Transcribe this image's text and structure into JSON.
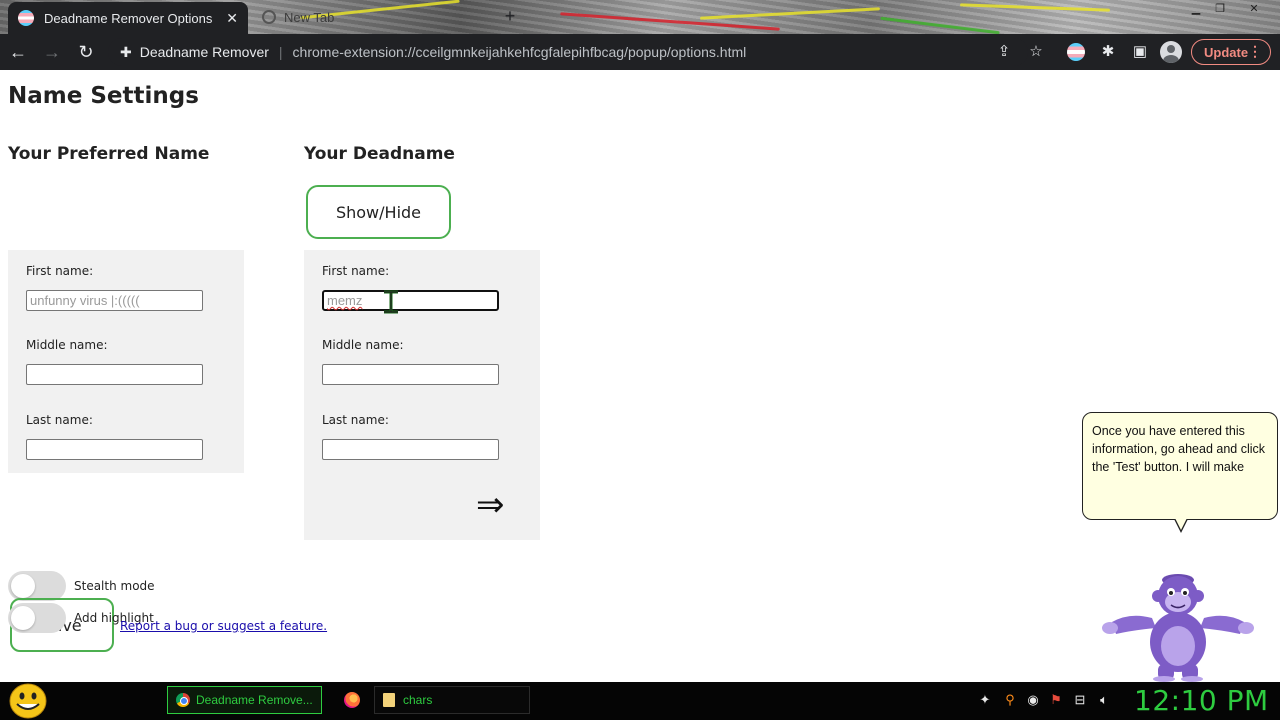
{
  "browser": {
    "active_tab_title": "Deadname Remover Options",
    "inactive_tab_title": "New Tab",
    "extension_name": "Deadname Remover",
    "url": "chrome-extension://cceilgmnkeijahkehfcgfalepihfbcag/popup/options.html",
    "update_label": "Update",
    "icons": [
      "back-icon",
      "forward-icon",
      "reload-icon",
      "puzzle-icon",
      "share-icon",
      "star-icon",
      "extensions-icon",
      "side-panel-icon",
      "profile-icon",
      "menu-icon"
    ]
  },
  "page": {
    "title": "Name Settings",
    "preferred": {
      "heading": "Your Preferred Name",
      "first_label": "First name:",
      "first_placeholder": "unfunny virus |:(((((",
      "middle_label": "Middle name:",
      "middle_value": "",
      "last_label": "Last name:",
      "last_value": ""
    },
    "deadname": {
      "heading": "Your Deadname",
      "showhide_label": "Show/Hide",
      "first_label": "First name:",
      "first_value": "memz",
      "middle_label": "Middle name:",
      "middle_value": "",
      "last_label": "Last name:",
      "last_value": "",
      "arrow_glyph": "⇒"
    },
    "toggles": [
      {
        "label": "Stealth mode",
        "on": false
      },
      {
        "label": "Add highlight",
        "on": false
      }
    ],
    "save_label": "Save",
    "report_link": "Report a bug or suggest a feature.",
    "accent_color": "#4caf50"
  },
  "assistant": {
    "bubble_text": "Once you have entered this information, go ahead and click the 'Test' button. I will make"
  },
  "taskbar": {
    "chrome_task": "Deadname Remove...",
    "chars_task": "chars",
    "clock": "12:10 PM",
    "clock_color": "#2ecc40"
  }
}
